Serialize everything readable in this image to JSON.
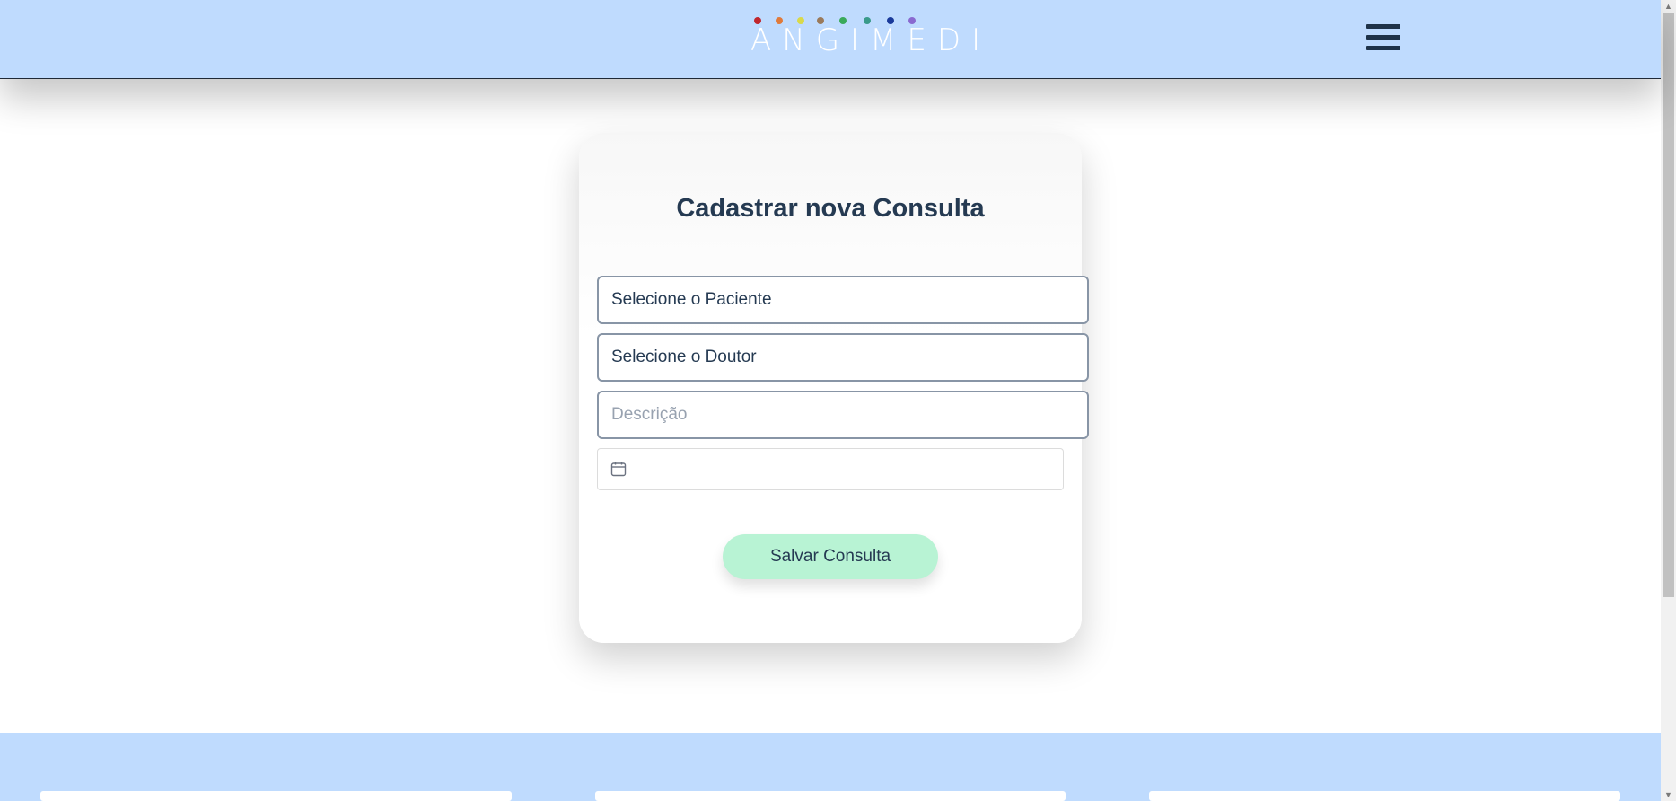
{
  "header": {
    "logo_text": "ANGIMEDI",
    "logo_dot_colors": [
      "#c0262d",
      "#e07a3a",
      "#d9d94a",
      "#9a7a5a",
      "#3aaa5a",
      "#3a9a8a",
      "#1a3a9a",
      "#8a6ad0"
    ],
    "menu_icon": "hamburger-menu-icon",
    "background_color": "#bfdbfe"
  },
  "form": {
    "title": "Cadastrar nova Consulta",
    "patient_select": "Selecione o Paciente",
    "doctor_select": "Selecione o Doutor",
    "description_placeholder": "Descrição",
    "date_icon": "calendar-icon",
    "save_label": "Salvar Consulta",
    "save_button_color": "#b8f3d4"
  },
  "footer": {
    "background_color": "#bfdbfe"
  }
}
